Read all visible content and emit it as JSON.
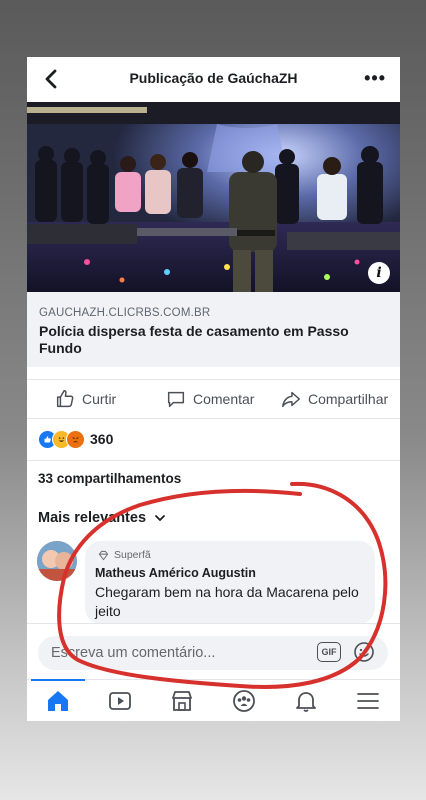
{
  "header": {
    "title": "Publicação de GaúchaZH",
    "back_icon": "chevron-left-icon",
    "more_icon": "more-dots-icon"
  },
  "post": {
    "link_domain": "GAUCHAZH.CLICRBS.COM.BR",
    "headline": "Polícia dispersa festa de casamento em Passo Fundo",
    "info_badge": "i"
  },
  "actions": {
    "like": "Curtir",
    "comment": "Comentar",
    "share": "Compartilhar"
  },
  "reactions": {
    "count": "360",
    "types": [
      "like-icon",
      "haha-icon",
      "angry-icon"
    ]
  },
  "shares": "33 compartilhamentos",
  "sort": {
    "label": "Mais relevantes"
  },
  "comment": {
    "badge": "Superfã",
    "author": "Matheus Américo Augustin",
    "text": "Chegaram bem na hora da Macarena pelo jeito"
  },
  "composer": {
    "placeholder": "Escreva um comentário...",
    "gif_label": "GIF"
  },
  "tabs": [
    "home-icon",
    "watch-icon",
    "marketplace-icon",
    "groups-icon",
    "notifications-icon",
    "menu-icon"
  ],
  "colors": {
    "accent": "#1877f2",
    "annotation": "#d6312c"
  }
}
